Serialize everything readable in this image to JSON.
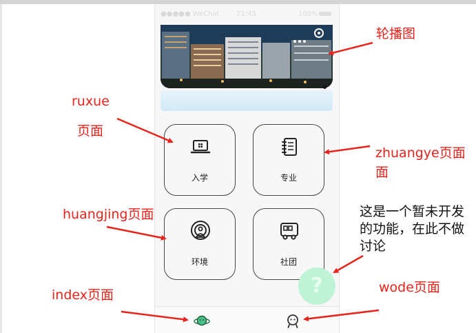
{
  "phone": {
    "status": {
      "carrier": "●●●●● WeChat",
      "time": "21:45",
      "battery": "100%"
    },
    "grid": [
      {
        "label": "入学",
        "icon": "laptop-icon"
      },
      {
        "label": "专业",
        "icon": "notebook-icon"
      },
      {
        "label": "环境",
        "icon": "location-icon"
      },
      {
        "label": "社团",
        "icon": "bus-icon"
      }
    ],
    "fab": {
      "label": "?"
    },
    "tabbar": {
      "index_icon": "planet-icon",
      "wode_icon": "face-icon"
    }
  },
  "annotations": {
    "banner": "轮播图",
    "ruxue_line1": "ruxue",
    "ruxue_line2": "页面",
    "zhuangye_line1": "zhuangye页面",
    "zhuangye_line2": "面",
    "huangjing": "huangjing页面",
    "index": "index页面",
    "wode": "wode页面",
    "note": "这是一个暂未开发的功能，在此不做讨论"
  },
  "colors": {
    "annotation": "#e8231b",
    "fab": "#bff3d6",
    "card_border": "#444444"
  }
}
